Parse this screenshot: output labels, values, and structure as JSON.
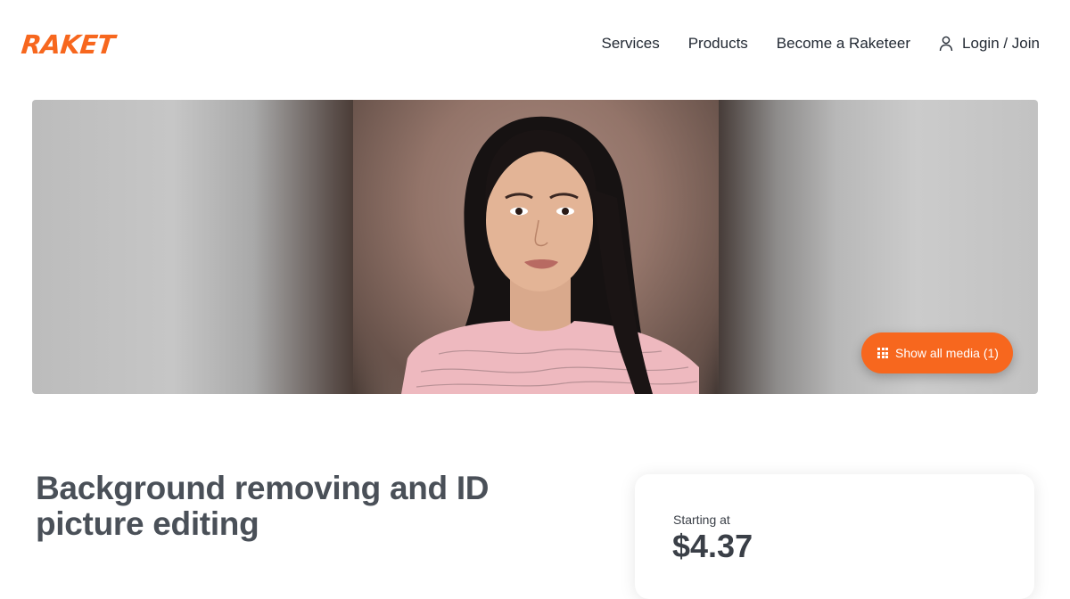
{
  "brand": {
    "logo_text": "RAKET",
    "accent_color": "#f7671e"
  },
  "nav": {
    "items": [
      {
        "label": "Services"
      },
      {
        "label": "Products"
      },
      {
        "label": "Become a Raketeer"
      }
    ],
    "login": {
      "label": "Login / Join",
      "icon": "user-icon"
    }
  },
  "hero": {
    "media_button": {
      "label": "Show all media (1)",
      "icon": "grid-icon"
    }
  },
  "listing": {
    "title": "Background removing and ID picture editing"
  },
  "pricing": {
    "label": "Starting at",
    "price": "$4.37"
  }
}
